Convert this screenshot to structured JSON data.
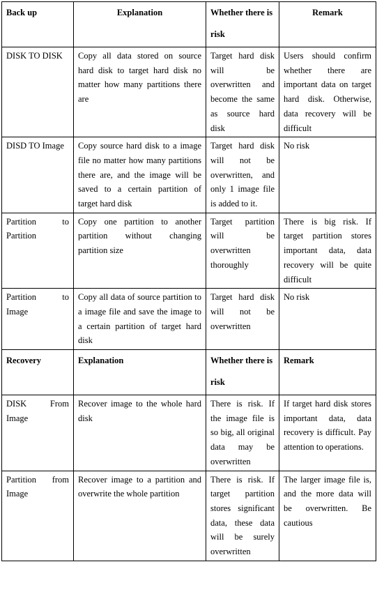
{
  "table": {
    "backup_header": {
      "col1": "Back up",
      "col2": "Explanation",
      "col3": "Whether there is risk",
      "col4": "Remark"
    },
    "backup_rows": [
      {
        "mode": "DISK TO DISK",
        "explanation": "Copy all data stored on source hard disk to target hard disk no matter how many partitions there are",
        "risk": "Target hard disk will be overwritten and become the same as source hard disk",
        "remark": "Users should confirm whether there are important data on target hard disk. Otherwise, data recovery will be difficult"
      },
      {
        "mode": "DISD TO Image",
        "explanation": "Copy source hard disk to a image file no matter how many partitions there are, and the image will be saved to a certain partition of target hard disk",
        "risk": "Target hard disk will not be overwritten, and only 1 image file is added to it.",
        "remark": "No risk"
      },
      {
        "mode": "Partition to Partition",
        "explanation": "Copy one partition to another partition without changing partition size",
        "risk": "Target partition will be overwritten thoroughly",
        "remark": "There is big risk. If target partition stores important data, data recovery will be quite difficult"
      },
      {
        "mode": "Partition to Image",
        "explanation": "Copy all data of source partition to a image file and save the image to a certain partition of target hard disk",
        "risk": "Target hard disk will not be overwritten",
        "remark": "No risk"
      }
    ],
    "recovery_header": {
      "col1": "Recovery",
      "col2": "Explanation",
      "col3": "Whether there is risk",
      "col4": "Remark"
    },
    "recovery_rows": [
      {
        "mode": "DISK From Image",
        "explanation": "Recover image to the whole hard disk",
        "risk": "There is risk. If the image file is so big, all original data may be overwritten",
        "remark": "If target hard disk stores important data, data recovery is difficult. Pay attention to operations."
      },
      {
        "mode": "Partition from Image",
        "explanation": "Recover image to a partition and overwrite the whole partition",
        "risk": "There is risk. If target partition stores significant data, these data will be surely overwritten",
        "remark": "The larger image file is, and the more data will be overwritten. Be cautious"
      }
    ]
  }
}
